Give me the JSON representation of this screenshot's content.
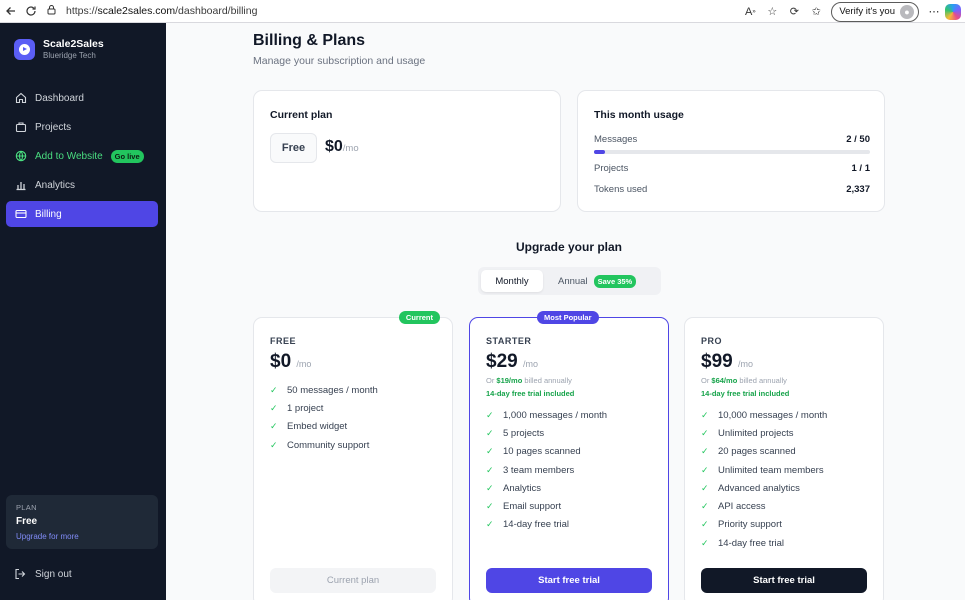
{
  "browser": {
    "url_prefix": "https://",
    "url_host": "scale2sales.com",
    "url_path": "/dashboard/billing",
    "verify_label": "Verify it's you"
  },
  "sidebar": {
    "brand_name": "Scale2Sales",
    "brand_org": "Blueridge Tech",
    "items": [
      {
        "label": "Dashboard",
        "icon": "home-icon"
      },
      {
        "label": "Projects",
        "icon": "briefcase-icon"
      },
      {
        "label": "Add to Website",
        "icon": "globe-icon",
        "badge": "Go live"
      },
      {
        "label": "Analytics",
        "icon": "bar-chart-icon"
      },
      {
        "label": "Billing",
        "icon": "credit-card-icon"
      }
    ],
    "plan_label": "PLAN",
    "plan_value": "Free",
    "upgrade_link": "Upgrade for more",
    "signout": "Sign out"
  },
  "header": {
    "title": "Billing & Plans",
    "subtitle": "Manage your subscription and usage"
  },
  "current_plan": {
    "heading": "Current plan",
    "name": "Free",
    "price": "$0",
    "per": "/mo"
  },
  "usage": {
    "heading": "This month usage",
    "messages_label": "Messages",
    "messages_value": "2 / 50",
    "messages_fraction": 0.04,
    "projects_label": "Projects",
    "projects_value": "1 / 1",
    "tokens_label": "Tokens used",
    "tokens_value": "2,337"
  },
  "upgrade": {
    "heading": "Upgrade your plan",
    "monthly": "Monthly",
    "annual": "Annual",
    "save_badge": "Save 35%"
  },
  "plans": {
    "free": {
      "name": "FREE",
      "price": "$0",
      "per": "/mo",
      "tag": "Current",
      "features": [
        "50 messages / month",
        "1 project",
        "Embed widget",
        "Community support"
      ],
      "button": "Current plan"
    },
    "starter": {
      "name": "STARTER",
      "price": "$29",
      "per": "/mo",
      "tag": "Most Popular",
      "note_prefix": "Or ",
      "note_price": "$19/mo",
      "note_suffix": " billed annually",
      "trial": "14-day free trial included",
      "features": [
        "1,000 messages / month",
        "5 projects",
        "10 pages scanned",
        "3 team members",
        "Analytics",
        "Email support",
        "14-day free trial"
      ],
      "button": "Start free trial"
    },
    "pro": {
      "name": "PRO",
      "price": "$99",
      "per": "/mo",
      "note_prefix": "Or ",
      "note_price": "$64/mo",
      "note_suffix": " billed annually",
      "trial": "14-day free trial included",
      "features": [
        "10,000 messages / month",
        "Unlimited projects",
        "20 pages scanned",
        "Unlimited team members",
        "Advanced analytics",
        "API access",
        "Priority support",
        "14-day free trial"
      ],
      "button": "Start free trial"
    }
  },
  "colors": {
    "sidebar_bg": "#111827",
    "accent": "#4f46e5",
    "success": "#22c55e"
  }
}
